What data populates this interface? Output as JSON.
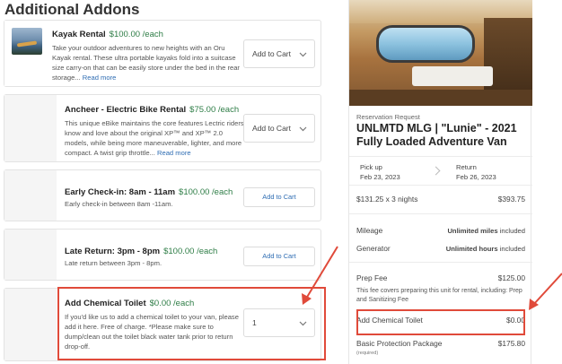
{
  "addons": {
    "heading": "Additional Addons",
    "items": [
      {
        "title": "Kayak Rental",
        "price": "$100.00 /each",
        "description": "Take your outdoor adventures to new heights with an Oru Kayak rental. These ultra portable kayaks fold into a suitcase size carry-on that can be easily store under the bed in the rear storage...",
        "read_more": "Read more",
        "control_label": "Add to Cart"
      },
      {
        "title": "Ancheer - Electric Bike Rental",
        "price": "$75.00 /each",
        "description": "This unique eBike maintains the core features Lectric riders know and love about the original XP™ and XP™ 2.0 models, while being more maneuverable, lighter, and more compact. A twist grip throttle...",
        "read_more": "Read more",
        "control_label": "Add to Cart"
      },
      {
        "title": "Early Check-in: 8am - 11am",
        "price": "$100.00 /each",
        "description": "Early check-in between 8am -11am.",
        "button_label": "Add to Cart"
      },
      {
        "title": "Late Return: 3pm - 8pm",
        "price": "$100.00 /each",
        "description": "Late return between 3pm - 8pm.",
        "button_label": "Add to Cart"
      },
      {
        "title": "Add Chemical Toilet",
        "price": "$0.00 /each",
        "description": "If you'd like us to add a chemical toilet to your van, please add it here. Free of charge. *Please make sure to dump/clean out the toilet black water tank prior to return drop-off.",
        "quantity": "1"
      }
    ]
  },
  "summary": {
    "request_label": "Reservation Request",
    "vehicle_title": "UNLMTD MLG | \"Lunie\" - 2021 Fully Loaded Adventure Van",
    "pickup_label": "Pick up",
    "pickup_date": "Feb 23, 2023",
    "return_label": "Return",
    "return_date": "Feb 26, 2023",
    "nights_label": "$131.25 x 3 nights",
    "nights_total": "$393.75",
    "mileage_label": "Mileage",
    "mileage_value": "Unlimited miles",
    "mileage_suffix": "included",
    "generator_label": "Generator",
    "generator_value": "Unlimited hours",
    "generator_suffix": "included",
    "prep_label": "Prep Fee",
    "prep_value": "$125.00",
    "prep_note": "This fee covers preparing this unit for rental, including: Prep and Sanitizing Fee",
    "toilet_label": "Add Chemical Toilet",
    "toilet_value": "$0.00",
    "protection_label": "Basic Protection Package",
    "protection_value": "$175.80",
    "protection_note": "(required)"
  },
  "colors": {
    "accent_green": "#2e7d46",
    "link_blue": "#2f6db3",
    "annotation_red": "#e04a3a"
  }
}
